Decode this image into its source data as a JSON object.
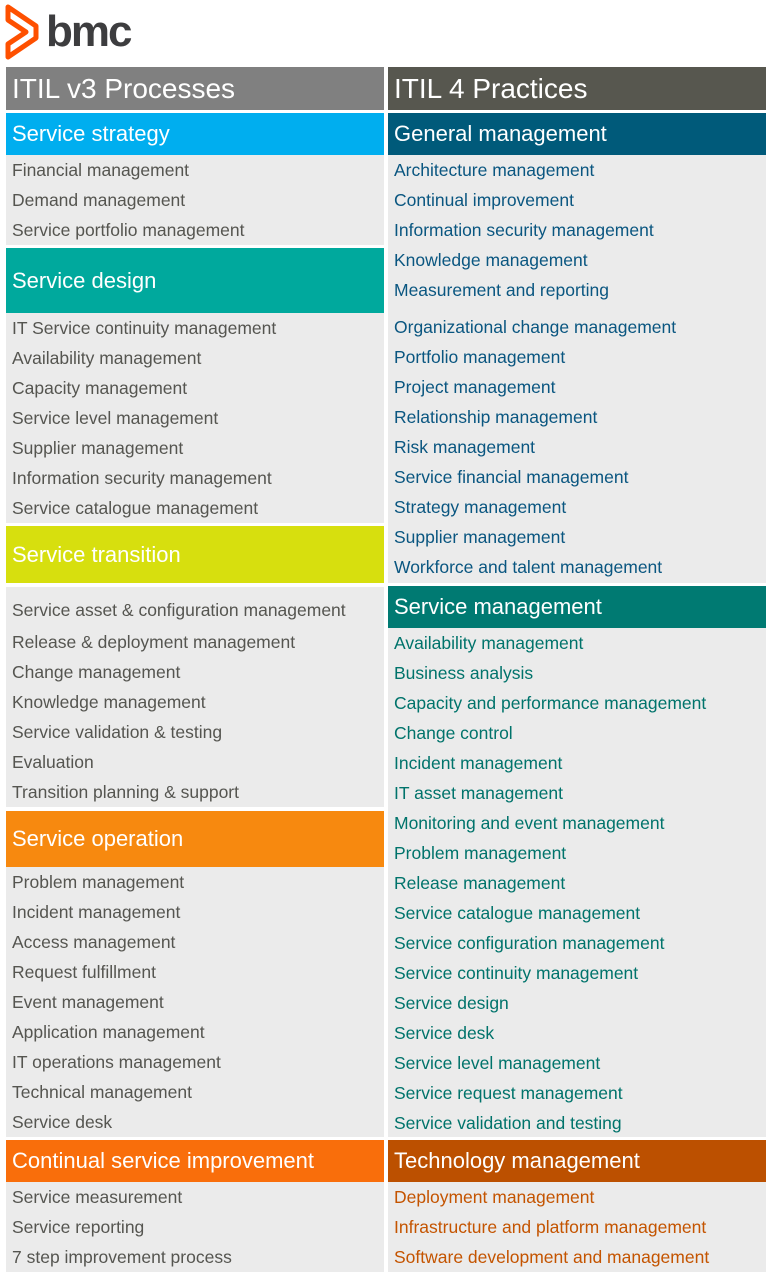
{
  "brand": {
    "name": "bmc",
    "logo_color": "#fe5000"
  },
  "left": {
    "title": "ITIL v3 Processes",
    "title_color": "#808080",
    "sections": [
      {
        "name": "Service strategy",
        "color": "#00aeef",
        "items": [
          "Financial management",
          "Demand management",
          "Service portfolio management"
        ]
      },
      {
        "name": "Service design",
        "color": "#00a99d",
        "items": [
          "IT Service continuity management",
          "Availability management",
          "Capacity management",
          "Service level management",
          "Supplier management",
          "Information security management",
          "Service catalogue management"
        ]
      },
      {
        "name": "Service transition",
        "color": "#d7df0e",
        "items": [
          "Service asset & configuration management",
          "Release & deployment management",
          "Change management",
          "Knowledge management",
          "Service validation & testing",
          "Evaluation",
          "Transition planning & support"
        ]
      },
      {
        "name": "Service operation",
        "color": "#f7890f",
        "items": [
          "Problem management",
          "Incident management",
          "Access management",
          "Request fulfillment",
          "Event management",
          "Application management",
          "IT operations management",
          "Technical management",
          "Service desk"
        ]
      },
      {
        "name": "Continual service improvement",
        "color": "#f96e0b",
        "items": [
          "Service measurement",
          "Service reporting",
          "7 step improvement process"
        ]
      }
    ]
  },
  "right": {
    "title": "ITIL 4 Practices",
    "title_color": "#57574f",
    "sections": [
      {
        "name": "General management",
        "color": "#005a7a",
        "text_color": "#0a5680",
        "items": [
          "Architecture management",
          "Continual improvement",
          "Information security management",
          "Knowledge management",
          "Measurement and reporting",
          "Organizational change management",
          "Portfolio management",
          "Project management",
          "Relationship management",
          "Risk management",
          "Service financial management",
          "Strategy management",
          "Supplier management",
          "Workforce and talent management"
        ]
      },
      {
        "name": "Service management",
        "color": "#007a72",
        "text_color": "#00736b",
        "items": [
          "Availability management",
          "Business analysis",
          "Capacity and performance management",
          "Change control",
          "Incident management",
          "IT asset management",
          "Monitoring and event management",
          "Problem management",
          "Release management",
          "Service catalogue management",
          "Service configuration management",
          "Service continuity management",
          "Service design",
          "Service desk",
          "Service level management",
          "Service request management",
          "Service validation and testing"
        ]
      },
      {
        "name": "Technology management",
        "color": "#bc5000",
        "text_color": "#c45400",
        "items": [
          "Deployment management",
          "Infrastructure and platform management",
          "Software development and management"
        ]
      }
    ]
  }
}
